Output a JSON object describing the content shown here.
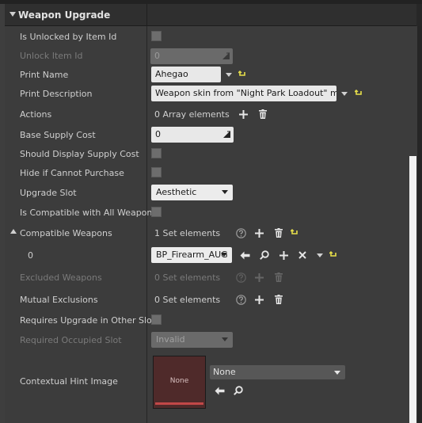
{
  "section": {
    "title": "Weapon Upgrade"
  },
  "rows": {
    "is_unlocked": {
      "label": "Is Unlocked by Item Id"
    },
    "unlock_item_id": {
      "label": "Unlock Item Id",
      "value": "0"
    },
    "print_name": {
      "label": "Print Name",
      "value": "Ahegao"
    },
    "print_description": {
      "label": "Print Description",
      "value": "Weapon skin from \"Night Park Loadout\" mod."
    },
    "actions": {
      "label": "Actions",
      "value": "0 Array elements"
    },
    "base_supply_cost": {
      "label": "Base Supply Cost",
      "value": "0"
    },
    "display_supply_cost": {
      "label": "Should Display Supply Cost"
    },
    "hide_cannot_purchase": {
      "label": "Hide if Cannot Purchase"
    },
    "upgrade_slot": {
      "label": "Upgrade Slot",
      "value": "Aesthetic"
    },
    "compatible_all": {
      "label": "Is Compatible with All Weapons"
    },
    "compatible_weapons": {
      "label": "Compatible Weapons",
      "value": "1 Set elements"
    },
    "compatible_item_0": {
      "label": "0",
      "value": "BP_Firearm_AUG"
    },
    "excluded_weapons": {
      "label": "Excluded Weapons",
      "value": "0 Set elements"
    },
    "mutual_exclusions": {
      "label": "Mutual Exclusions",
      "value": "0 Set elements"
    },
    "requires_other_slot": {
      "label": "Requires Upgrade in Other Slot"
    },
    "required_occupied_slot": {
      "label": "Required Occupied Slot",
      "value": "Invalid"
    },
    "contextual_hint_image": {
      "label": "Contextual Hint Image",
      "thumbnail_text": "None",
      "value": "None"
    }
  },
  "colors": {
    "accent_yellow": "#e8e04a",
    "thumb_bg": "#4f2a2a",
    "thumb_bar": "#c24848"
  },
  "icons": [
    "dropdown-icon",
    "reset-arrow-icon",
    "plus-icon",
    "trash-icon",
    "help-icon",
    "back-arrow-icon",
    "search-icon",
    "close-icon"
  ]
}
